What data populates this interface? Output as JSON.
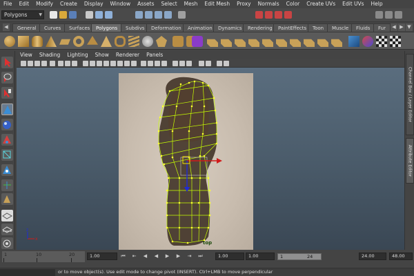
{
  "menubar": {
    "items": [
      "File",
      "Edit",
      "Modify",
      "Create",
      "Display",
      "Window",
      "Assets",
      "Select",
      "Mesh",
      "Edit Mesh",
      "Proxy",
      "Normals",
      "Color",
      "Create UVs",
      "Edit UVs",
      "Help"
    ]
  },
  "status_line": {
    "mode": "Polygons"
  },
  "shelf": {
    "tabs": [
      "General",
      "Curves",
      "Surfaces",
      "Polygons",
      "Subdivs",
      "Deformation",
      "Animation",
      "Dynamics",
      "Rendering",
      "PaintEffects",
      "Toon",
      "Muscle",
      "Fluids",
      "Fur"
    ],
    "active_tab": "Polygons"
  },
  "panel": {
    "menu": [
      "View",
      "Shading",
      "Lighting",
      "Show",
      "Renderer",
      "Panels"
    ]
  },
  "viewport": {
    "camera_label": "top"
  },
  "dock": {
    "tabs": [
      "Channel Box / Layer Editor",
      "Attribute Editor"
    ]
  },
  "timeline": {
    "ticks": [
      "1",
      "10",
      "20"
    ],
    "current_frame": "1.00",
    "range_start": "1.00",
    "range_start_2": "1.00",
    "range_slider_start": "1",
    "range_slider_end": "24",
    "range_end": "24.00",
    "anim_end": "48.00"
  },
  "help_line": {
    "text": "or to move object(s). Use edit mode to change pivot (INSERT).  Ctrl+LMB to move perpendicular"
  },
  "colors": {
    "viewport_bg": "#4b5c6b",
    "mesh_wire": "#c8ff00",
    "manipulator_x": "#d11a1a",
    "manipulator_z": "#1f2bd6",
    "active_tab": "#6a6a6a"
  }
}
